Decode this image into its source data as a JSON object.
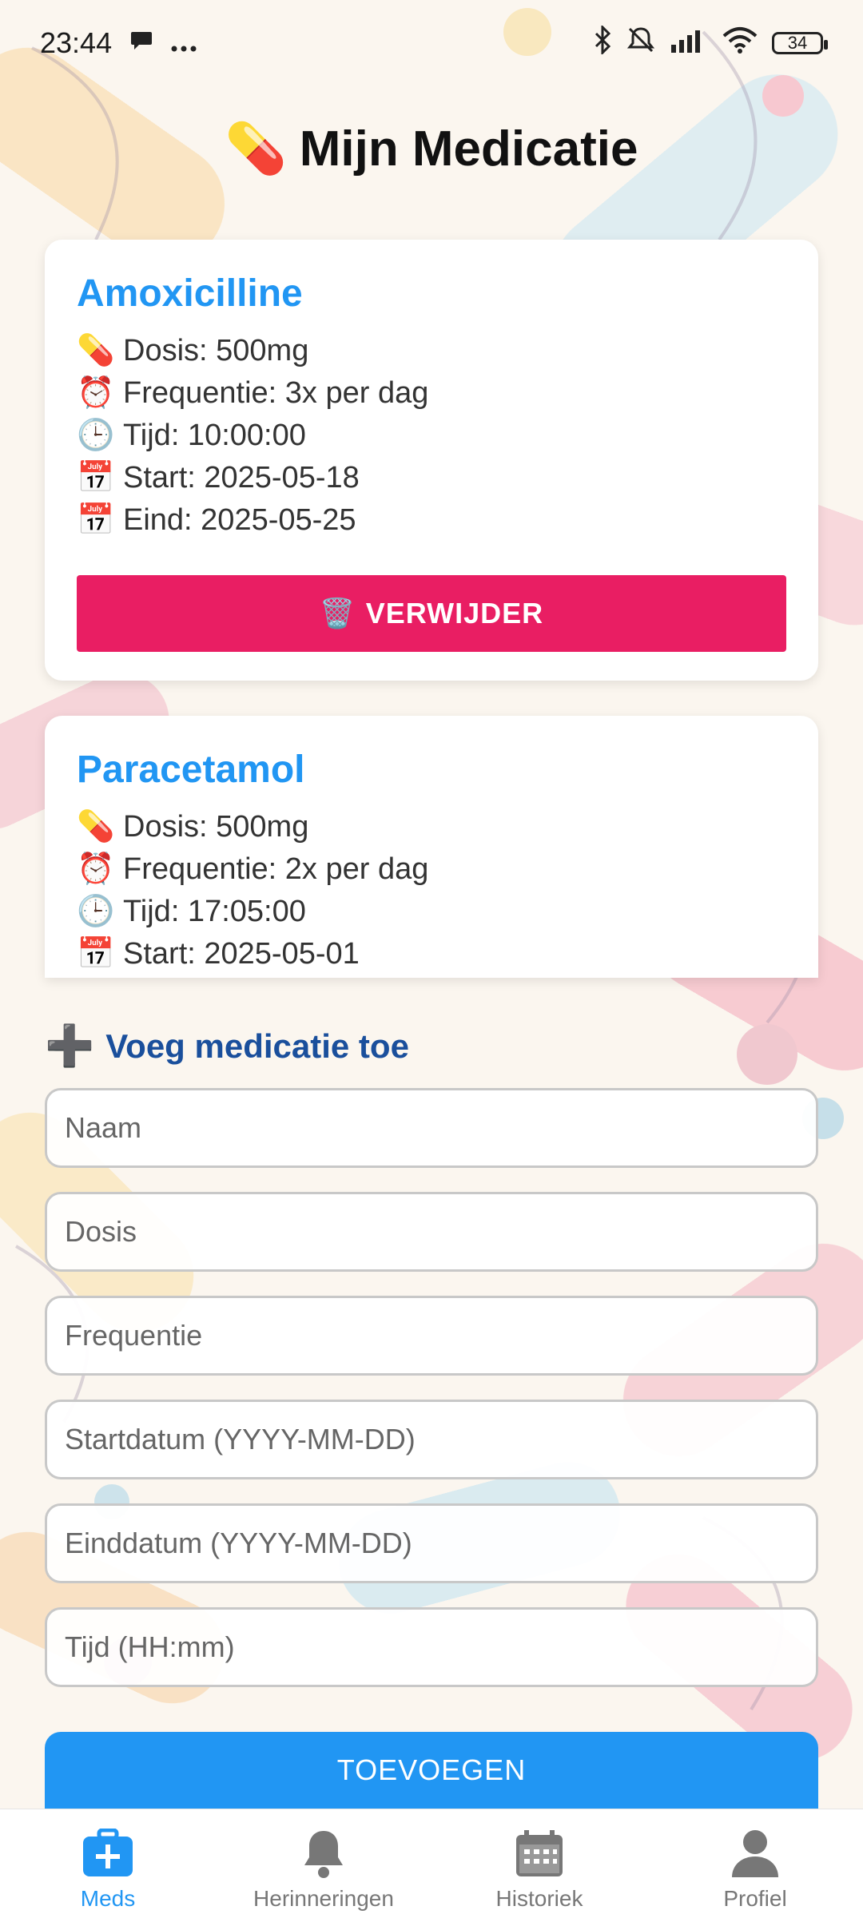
{
  "status_bar": {
    "time": "23:44",
    "notification_icons": [
      "chat-bubble-icon",
      "more-dots-icon"
    ],
    "system_icons": [
      "bluetooth-icon",
      "bell-muted-icon",
      "signal-icon",
      "wifi-icon"
    ],
    "battery": "34"
  },
  "header": {
    "emoji": "💊",
    "title": "Mijn Medicatie"
  },
  "medications": [
    {
      "name": "Amoxicilline",
      "lines": [
        {
          "icon": "💊",
          "text": "Dosis: 500mg"
        },
        {
          "icon": "⏰",
          "text": "Frequentie: 3x per dag"
        },
        {
          "icon": "🕒",
          "text": "Tijd: 10:00:00"
        },
        {
          "icon": "📅",
          "text": "Start: 2025-05-18"
        },
        {
          "icon": "📅",
          "text": "Eind: 2025-05-25"
        }
      ],
      "delete_icon": "🗑️",
      "delete_label": "VERWIJDER"
    },
    {
      "name": "Paracetamol",
      "lines": [
        {
          "icon": "💊",
          "text": "Dosis: 500mg"
        },
        {
          "icon": "⏰",
          "text": "Frequentie: 2x per dag"
        },
        {
          "icon": "🕒",
          "text": "Tijd: 17:05:00"
        },
        {
          "icon": "📅",
          "text": "Start: 2025-05-01"
        }
      ]
    }
  ],
  "add_form": {
    "heading_icon": "➕",
    "heading": "Voeg medicatie toe",
    "fields": {
      "name": {
        "placeholder": "Naam",
        "value": ""
      },
      "dose": {
        "placeholder": "Dosis",
        "value": ""
      },
      "frequency": {
        "placeholder": "Frequentie",
        "value": ""
      },
      "start": {
        "placeholder": "Startdatum (YYYY-MM-DD)",
        "value": ""
      },
      "end": {
        "placeholder": "Einddatum (YYYY-MM-DD)",
        "value": ""
      },
      "time": {
        "placeholder": "Tijd (HH:mm)",
        "value": ""
      }
    },
    "submit_label": "TOEVOEGEN"
  },
  "bottom_nav": {
    "items": [
      {
        "label": "Meds",
        "icon": "medkit-icon",
        "active": true
      },
      {
        "label": "Herinneringen",
        "icon": "bell-icon",
        "active": false
      },
      {
        "label": "Historiek",
        "icon": "calendar-icon",
        "active": false
      },
      {
        "label": "Profiel",
        "icon": "person-icon",
        "active": false
      }
    ]
  },
  "colors": {
    "accent": "#2196f3",
    "delete": "#e91e63",
    "heading": "#1a4f9c"
  }
}
